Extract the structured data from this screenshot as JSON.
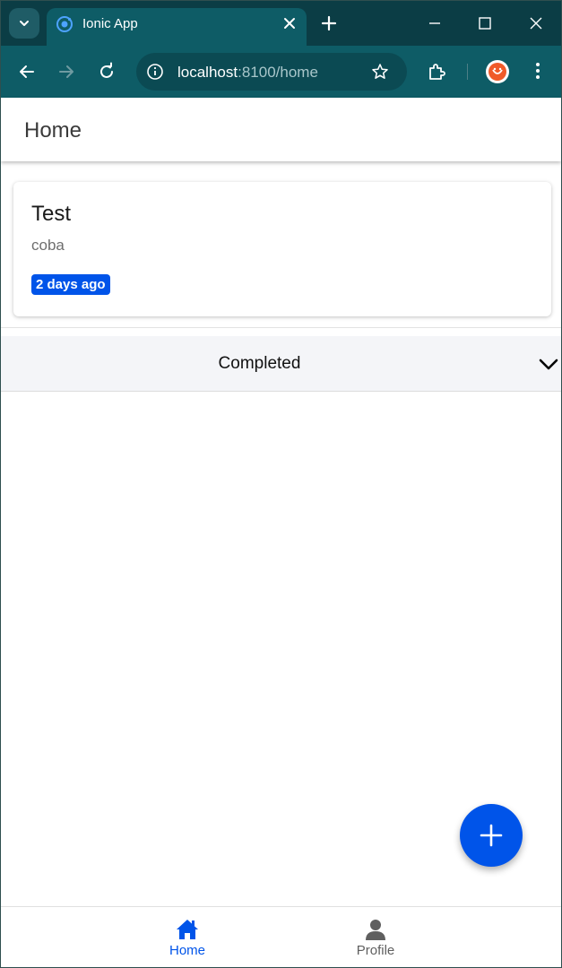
{
  "browser": {
    "tab_title": "Ionic App",
    "url_host": "localhost",
    "url_path": ":8100/home"
  },
  "app": {
    "header_title": "Home",
    "card": {
      "title": "Test",
      "subtitle": "coba",
      "badge": "2 days ago"
    },
    "accordion_label": "Completed",
    "tabs": [
      {
        "label": "Home",
        "icon": "home-icon",
        "active": true
      },
      {
        "label": "Profile",
        "icon": "person-icon",
        "active": false
      }
    ],
    "fab_icon": "add-icon"
  },
  "colors": {
    "primary": "#0054e9",
    "browser_chrome": "#0e5c66",
    "accordion_bg": "#f4f5f8"
  }
}
